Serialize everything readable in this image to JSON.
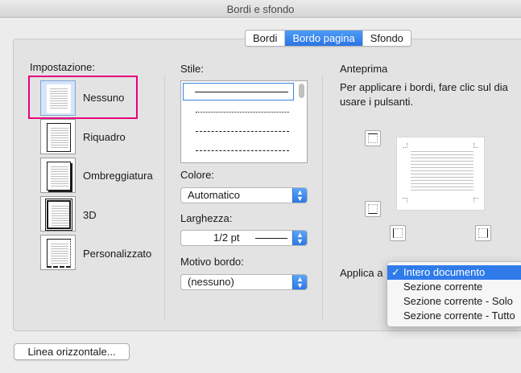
{
  "window": {
    "title": "Bordi e sfondo"
  },
  "tabs": [
    {
      "label": "Bordi",
      "selected": false
    },
    {
      "label": "Bordo pagina",
      "selected": true
    },
    {
      "label": "Sfondo",
      "selected": false
    }
  ],
  "setting": {
    "label": "Impostazione:",
    "options": [
      {
        "label": "Nessuno",
        "icon": "page-no-border-icon",
        "selected": true
      },
      {
        "label": "Riquadro",
        "icon": "page-box-border-icon",
        "selected": false
      },
      {
        "label": "Ombreggiatura",
        "icon": "page-shadow-border-icon",
        "selected": false
      },
      {
        "label": "3D",
        "icon": "page-3d-border-icon",
        "selected": false
      },
      {
        "label": "Personalizzato",
        "icon": "page-custom-border-icon",
        "selected": false
      }
    ]
  },
  "style": {
    "label": "Stile:",
    "line_styles": [
      "solid",
      "dotted",
      "dashed",
      "long-dashed"
    ]
  },
  "color": {
    "label": "Colore:",
    "value": "Automatico"
  },
  "width": {
    "label": "Larghezza:",
    "value": "1/2 pt"
  },
  "art": {
    "label": "Motivo bordo:",
    "value": "(nessuno)"
  },
  "preview": {
    "label": "Anteprima",
    "instructions_line1": "Per applicare i bordi, fare clic sul dia",
    "instructions_line2": "usare i pulsanti."
  },
  "apply_to": {
    "label": "Applica a",
    "options": [
      {
        "label": "Intero documento",
        "selected": true
      },
      {
        "label": "Sezione corrente",
        "selected": false
      },
      {
        "label": "Sezione corrente - Solo",
        "selected": false
      },
      {
        "label": "Sezione corrente - Tutto",
        "selected": false
      }
    ]
  },
  "buttons": {
    "horizontal_line": "Linea orizzontale..."
  },
  "colors": {
    "accent": "#2f7bea",
    "highlight": "#e6007e"
  }
}
